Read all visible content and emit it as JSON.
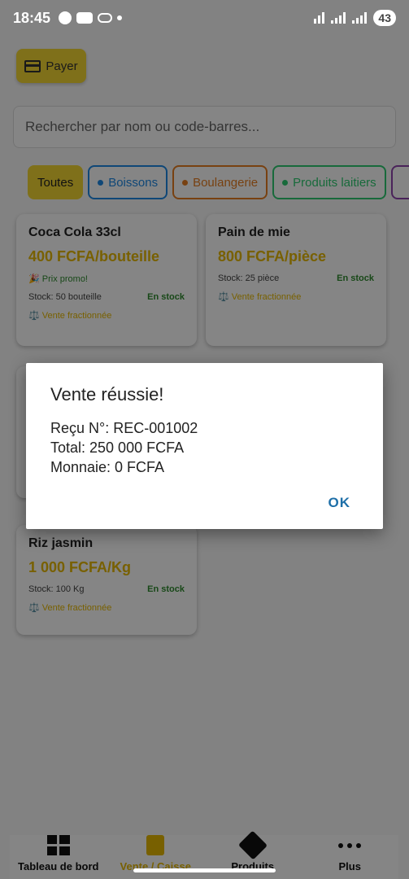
{
  "status_bar": {
    "time": "18:45",
    "battery": "43"
  },
  "header": {
    "pay_label": "Payer"
  },
  "search": {
    "placeholder": "Rechercher par nom ou code-barres..."
  },
  "categories": [
    {
      "label": "Toutes",
      "color": "#f4d633"
    },
    {
      "label": "Boissons",
      "color": "#1e88e5"
    },
    {
      "label": "Boulangerie",
      "color": "#e67e22"
    },
    {
      "label": "Produits laitiers",
      "color": "#2ecc71"
    }
  ],
  "products": [
    {
      "name": "Coca Cola 33cl",
      "price": "400 FCFA/bouteille",
      "promo": "🎉 Prix promo!",
      "stock": "Stock: 50 bouteille",
      "availability": "En stock",
      "fractional": "⚖️ Vente fractionnée"
    },
    {
      "name": "Pain de mie",
      "price": "800 FCFA/pièce",
      "stock": "Stock: 25 pièce",
      "availability": "En stock",
      "fractional": "⚖️ Vente fractionnée"
    },
    {
      "name": "Riz jasmin",
      "price": "1 000 FCFA/Kg",
      "stock": "Stock: 100 Kg",
      "availability": "En stock",
      "fractional": "⚖️ Vente fractionnée"
    }
  ],
  "dialog": {
    "title": "Vente réussie!",
    "receipt": "Reçu N°: REC-001002",
    "total": "Total: 250 000 FCFA",
    "change": "Monnaie: 0 FCFA",
    "ok_label": "OK"
  },
  "bottom_nav": [
    {
      "label": "Tableau de bord",
      "icon": "dashboard-icon"
    },
    {
      "label": "Vente / Caisse",
      "icon": "calculator-icon",
      "active": true
    },
    {
      "label": "Produits",
      "icon": "cube-icon"
    },
    {
      "label": "Plus",
      "icon": "more-icon"
    }
  ],
  "colors": {
    "accent": "#f4d633",
    "price": "#e6b800",
    "in_stock": "#2e8b2e",
    "dialog_button": "#1e6fa8"
  }
}
